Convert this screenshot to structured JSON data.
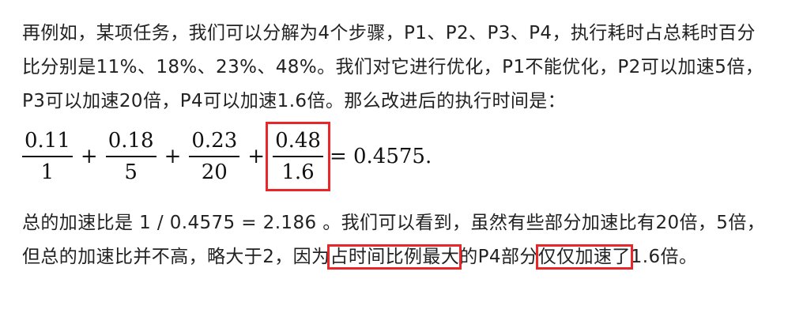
{
  "paragraph1": "再例如，某项任务，我们可以分解为4个步骤，P1、P2、P3、P4，执行耗时占总耗时百分比分别是11%、18%、23%、48%。我们对它进行优化，P1不能优化，P2可以加速5倍，P3可以加速20倍，P4可以加速1.6倍。那么改进后的执行时间是：",
  "formula": {
    "terms": [
      {
        "num": "0.11",
        "den": "1"
      },
      {
        "num": "0.18",
        "den": "5"
      },
      {
        "num": "0.23",
        "den": "20"
      },
      {
        "num": "0.48",
        "den": "1.6"
      }
    ],
    "plus": "+",
    "result": "= 0.4575."
  },
  "paragraph2": {
    "before": "总的加速比是 1 / 0.4575 = 2.186 。我们可以看到，虽然有些部分加速比有20倍，5倍，但总的加速比并不高，略大于2，因为",
    "highlight1": "占时间比例最大",
    "middle": "的P4部分",
    "highlight2": "仅仅加速了",
    "after": "1.6倍。"
  },
  "annotation_color": "#e8272b"
}
